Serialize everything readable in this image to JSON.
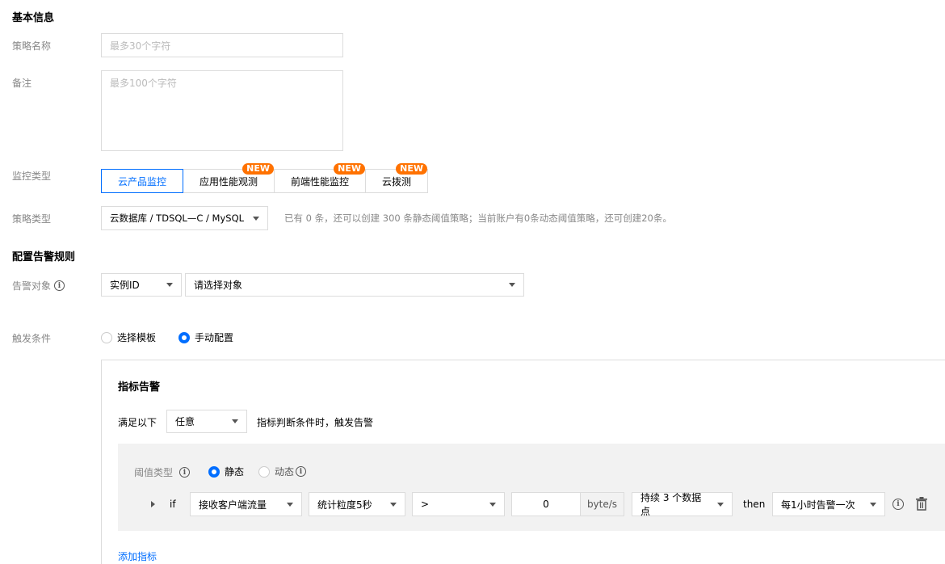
{
  "basic_info": {
    "title": "基本信息",
    "policy_name_label": "策略名称",
    "policy_name_placeholder": "最多30个字符",
    "remark_label": "备注",
    "remark_placeholder": "最多100个字符",
    "monitor_type_label": "监控类型",
    "monitor_tabs": [
      {
        "label": "云产品监控",
        "badge": ""
      },
      {
        "label": "应用性能观测",
        "badge": "NEW"
      },
      {
        "label": "前端性能监控",
        "badge": "NEW"
      },
      {
        "label": "云拨测",
        "badge": "NEW"
      }
    ],
    "policy_type_label": "策略类型",
    "policy_type_value": "云数据库 / TDSQL—C / MySQL",
    "policy_type_hint": "已有 0 条，还可以创建 300 条静态阈值策略；当前账户有0条动态阈值策略，还可创建20条。"
  },
  "alarm_rules": {
    "title": "配置告警规则",
    "alarm_object_label": "告警对象",
    "object_type_value": "实例ID",
    "object_select_value": "请选择对象",
    "trigger_label": "触发条件",
    "trigger_options": [
      "选择模板",
      "手动配置"
    ],
    "trigger_selected": "手动配置"
  },
  "metric_alarm": {
    "title": "指标告警",
    "satisfy_prefix": "满足以下",
    "satisfy_value": "任意",
    "satisfy_suffix": "指标判断条件时，触发告警",
    "threshold_type_label": "阈值类型",
    "threshold_options": [
      "静态",
      "动态"
    ],
    "threshold_selected": "静态",
    "rule": {
      "if_label": "if",
      "metric": "接收客户端流量",
      "granularity": "统计粒度5秒",
      "operator": ">",
      "value": "0",
      "unit": "byte/s",
      "duration": "持续 3 个数据点",
      "then_label": "then",
      "frequency": "每1小时告警一次"
    },
    "add_metric_link": "添加指标"
  },
  "colors": {
    "accent": "#006eff",
    "badge": "#ff7200",
    "label": "#888888",
    "border": "#dcdcdc"
  }
}
